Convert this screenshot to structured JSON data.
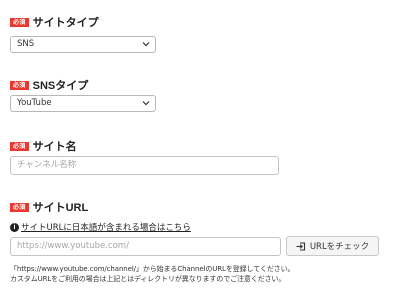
{
  "required_badge": "必須",
  "fields": {
    "site_type": {
      "label": "サイトタイプ",
      "value": "SNS"
    },
    "sns_type": {
      "label": "SNSタイプ",
      "value": "YouTube"
    },
    "site_name": {
      "label": "サイト名",
      "placeholder": "チャンネル名称"
    },
    "site_url": {
      "label": "サイトURL",
      "info_link": "サイトURLに日本語が含まれる場合はこちら",
      "placeholder": "https://www.youtube.com/",
      "check_button": "URLをチェック",
      "note_line1": "「https://www.youtube.com/channel/」から始まるChannelのURLを登録してください。",
      "note_line2": "カスタムURLをご利用の場合は上記とはディレクトリが異なりますのでご注意ください。"
    }
  }
}
